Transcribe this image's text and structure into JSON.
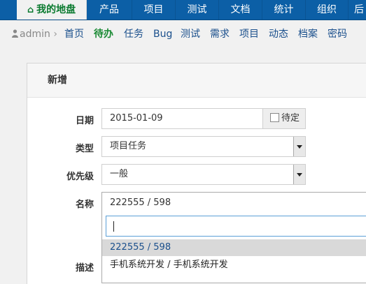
{
  "topnav": {
    "items": [
      {
        "label": "我的地盘",
        "icon": "home-icon",
        "active": true
      },
      {
        "label": "产品"
      },
      {
        "label": "项目"
      },
      {
        "label": "测试"
      },
      {
        "label": "文档"
      },
      {
        "label": "统计"
      },
      {
        "label": "组织"
      },
      {
        "label": "后"
      }
    ]
  },
  "subnav": {
    "user": "admin",
    "separator": "›",
    "items": [
      "首页",
      "待办",
      "任务",
      "Bug",
      "测试",
      "需求",
      "项目",
      "动态",
      "档案",
      "密码"
    ],
    "active": "待办"
  },
  "form": {
    "title": "新增",
    "date": {
      "label": "日期",
      "value": "2015-01-09",
      "pending_label": "待定",
      "pending_checked": false
    },
    "type": {
      "label": "类型",
      "value": "项目任务"
    },
    "priority": {
      "label": "优先级",
      "value": "一般"
    },
    "name": {
      "label": "名称",
      "value": "222555 / 598",
      "search_value": "",
      "results": [
        "222555 / 598",
        "手机系统开发 / 手机系统开发"
      ],
      "highlighted_index": 0
    },
    "description": {
      "label": "描述"
    }
  },
  "colors": {
    "nav_bg": "#0c5fa6",
    "active_green": "#0a7a2f",
    "link_blue": "#1a4f8c",
    "highlight_bg": "#d9d9d9",
    "focus_border": "#5b9fd6"
  }
}
